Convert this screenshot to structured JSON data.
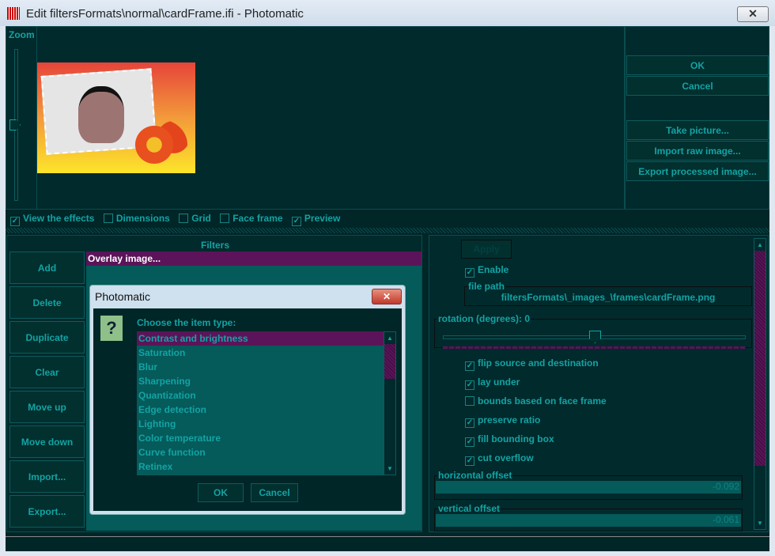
{
  "window": {
    "title": "Edit filtersFormats\\normal\\cardFrame.ifi - Photomatic",
    "close": "✕"
  },
  "preview": {
    "zoom_label": "Zoom",
    "zoom_level": 0.5
  },
  "right_buttons": {
    "ok": "OK",
    "cancel": "Cancel",
    "take_picture": "Take picture...",
    "import_raw": "Import raw image...",
    "export_processed": "Export processed image..."
  },
  "options": [
    {
      "label": "View the effects",
      "checked": true
    },
    {
      "label": "Dimensions",
      "checked": false
    },
    {
      "label": "Grid",
      "checked": false
    },
    {
      "label": "Face frame",
      "checked": false
    },
    {
      "label": "Preview",
      "checked": true
    }
  ],
  "filters": {
    "header": "Filters",
    "buttons": [
      "Add",
      "Delete",
      "Duplicate",
      "Clear",
      "Move up",
      "Move down",
      "Import...",
      "Export..."
    ],
    "items": [
      "Overlay image..."
    ]
  },
  "settings": {
    "apply": "Apply",
    "enable": {
      "label": "Enable",
      "checked": true
    },
    "file_path_label": "file path",
    "file_path": "filtersFormats\\_images_\\frames\\cardFrame.png",
    "rotation_label": "rotation (degrees): 0",
    "rotation_value": 0,
    "checks": [
      {
        "label": "flip source and destination",
        "checked": true
      },
      {
        "label": "lay under",
        "checked": true
      },
      {
        "label": "bounds based on face frame",
        "checked": false
      },
      {
        "label": "preserve ratio",
        "checked": true
      },
      {
        "label": "fill bounding box",
        "checked": true
      },
      {
        "label": "cut overflow",
        "checked": true
      }
    ],
    "horizontal_offset_label": "horizontal offset",
    "horizontal_offset": "-0.092",
    "vertical_offset_label": "vertical offset",
    "vertical_offset": "-0.061"
  },
  "dialog": {
    "title": "Photomatic",
    "prompt": "Choose the item type:",
    "items": [
      "Contrast and brightness",
      "Saturation",
      "Blur",
      "Sharpening",
      "Quantization",
      "Edge detection",
      "Lighting",
      "Color temperature",
      "Curve function",
      "Retinex"
    ],
    "ok": "OK",
    "cancel": "Cancel"
  },
  "colors": {
    "accent": "#13a3a3",
    "selection": "#5b1459",
    "background": "#012628"
  }
}
